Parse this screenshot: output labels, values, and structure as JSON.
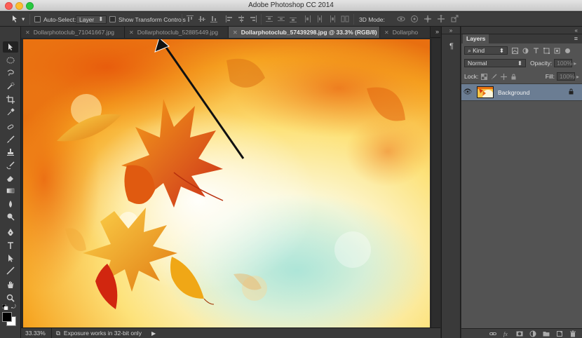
{
  "window": {
    "title": "Adobe Photoshop CC 2014"
  },
  "options_bar": {
    "auto_select_label": "Auto-Select:",
    "auto_select_value": "Layer",
    "show_transform_label": "Show Transform Controls",
    "mode_3d_label": "3D Mode:"
  },
  "tabs": [
    {
      "label": "Dollarphotoclub_71041667.jpg",
      "active": false
    },
    {
      "label": "Dollarphotoclub_52885449.jpg",
      "active": false
    },
    {
      "label": "Dollarphotoclub_57439298.jpg @ 33.3% (RGB/8)",
      "active": true
    },
    {
      "label": "Dollarpho",
      "active": false
    }
  ],
  "tabs_overflow": "»",
  "status": {
    "zoom": "33.33%",
    "info": "Exposure works in 32-bit only"
  },
  "layers_panel": {
    "title": "Layers",
    "filter_label": "Kind",
    "blend_mode": "Normal",
    "opacity_label": "Opacity:",
    "opacity_value": "100%",
    "lock_label": "Lock:",
    "fill_label": "Fill:",
    "fill_value": "100%",
    "layers": [
      {
        "name": "Background",
        "visible": true,
        "locked": true
      }
    ]
  },
  "colors": {
    "panel_bg": "#535353",
    "selected_layer": "#6b7d93",
    "foreground": "#000000",
    "background": "#ffffff"
  },
  "icons": {
    "tools": [
      "move-tool-icon",
      "marquee-tool-icon",
      "lasso-tool-icon",
      "quick-select-tool-icon",
      "crop-tool-icon",
      "eyedropper-tool-icon",
      "healing-brush-icon",
      "brush-tool-icon",
      "clone-stamp-icon",
      "history-brush-icon",
      "eraser-tool-icon",
      "gradient-tool-icon",
      "blur-tool-icon",
      "dodge-tool-icon",
      "pen-tool-icon",
      "type-tool-icon",
      "path-select-icon",
      "line-tool-icon",
      "hand-tool-icon",
      "zoom-tool-icon"
    ]
  }
}
